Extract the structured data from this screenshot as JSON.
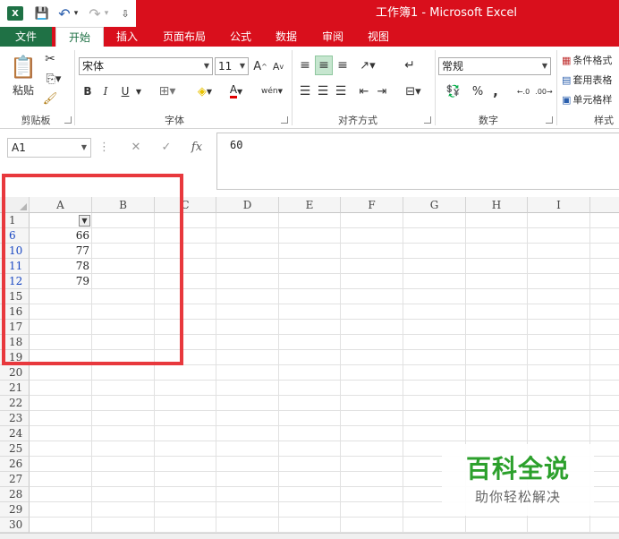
{
  "window": {
    "title": "工作簿1 - Microsoft Excel",
    "qat": {
      "excel_icon": "X",
      "save_glyph": "💾",
      "undo_glyph": "↶",
      "undo_dd": "▾",
      "redo_glyph": "↷",
      "redo_dd": "▾",
      "customize_glyph": "⇩"
    }
  },
  "tabs": [
    "文件",
    "开始",
    "插入",
    "页面布局",
    "公式",
    "数据",
    "审阅",
    "视图"
  ],
  "ribbon": {
    "clipboard": {
      "paste": "粘贴",
      "label": "剪贴板"
    },
    "font": {
      "name": "宋体",
      "size": "11",
      "bold": "B",
      "italic": "I",
      "underline": "U",
      "grow": "A",
      "shrink": "A",
      "color_a": "A",
      "phonetic": "wén",
      "label": "字体"
    },
    "alignment": {
      "label": "对齐方式"
    },
    "number": {
      "format": "常规",
      "percent": "%",
      "comma": ",",
      "dec_inc": "←.0",
      "dec_dec": ".00→",
      "label": "数字"
    },
    "styles": {
      "conditional": "条件格式",
      "table": "套用表格",
      "cell": "单元格样",
      "label": "样式"
    },
    "accent": "#d90f1c",
    "file_tab_color": "#1f7145"
  },
  "formula_bar": {
    "name_box": "A1",
    "cancel": "✕",
    "enter": "✓",
    "fx": "fx",
    "value": "60"
  },
  "grid": {
    "columns": [
      "A",
      "B",
      "C",
      "D",
      "E",
      "F",
      "G",
      "H",
      "I"
    ],
    "rows": [
      {
        "num": "1",
        "filtered": false,
        "a": ""
      },
      {
        "num": "6",
        "filtered": true,
        "a": "66"
      },
      {
        "num": "10",
        "filtered": true,
        "a": "77"
      },
      {
        "num": "11",
        "filtered": true,
        "a": "78"
      },
      {
        "num": "12",
        "filtered": true,
        "a": "79"
      },
      {
        "num": "15",
        "filtered": false,
        "a": ""
      },
      {
        "num": "16",
        "filtered": false,
        "a": ""
      },
      {
        "num": "17",
        "filtered": false,
        "a": ""
      },
      {
        "num": "18",
        "filtered": false,
        "a": ""
      },
      {
        "num": "19",
        "filtered": false,
        "a": ""
      },
      {
        "num": "20",
        "filtered": false,
        "a": ""
      },
      {
        "num": "21",
        "filtered": false,
        "a": ""
      },
      {
        "num": "22",
        "filtered": false,
        "a": ""
      },
      {
        "num": "23",
        "filtered": false,
        "a": ""
      },
      {
        "num": "24",
        "filtered": false,
        "a": ""
      },
      {
        "num": "25",
        "filtered": false,
        "a": ""
      },
      {
        "num": "26",
        "filtered": false,
        "a": ""
      },
      {
        "num": "27",
        "filtered": false,
        "a": ""
      },
      {
        "num": "28",
        "filtered": false,
        "a": ""
      },
      {
        "num": "29",
        "filtered": false,
        "a": ""
      },
      {
        "num": "30",
        "filtered": false,
        "a": ""
      }
    ],
    "filter_glyph": "▼",
    "highlight_color": "#e8383d"
  },
  "watermark": {
    "line1": "百科全说",
    "line2": "助你轻松解决"
  }
}
